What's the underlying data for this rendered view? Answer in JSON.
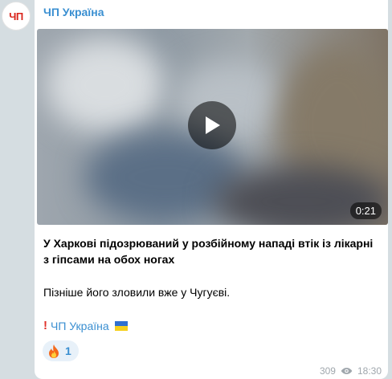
{
  "channel": {
    "avatar_text": "ЧП",
    "name": "ЧП Україна"
  },
  "video": {
    "duration": "0:21"
  },
  "message": {
    "headline": "У Харкові підозрюваний у розбійному нападі втік із лікарні з гіпсами на обох ногах",
    "body": "Пізніше його зловили вже у Чугуєві.",
    "signature": "ЧП Україна"
  },
  "reaction": {
    "emoji": "fire-emoji",
    "count": "1"
  },
  "meta": {
    "views": "309",
    "time": "18:30"
  },
  "colors": {
    "accent": "#3a8fd1",
    "background": "#d5dde1",
    "bubble": "#ffffff",
    "reaction_bg": "#e8f1f9"
  }
}
